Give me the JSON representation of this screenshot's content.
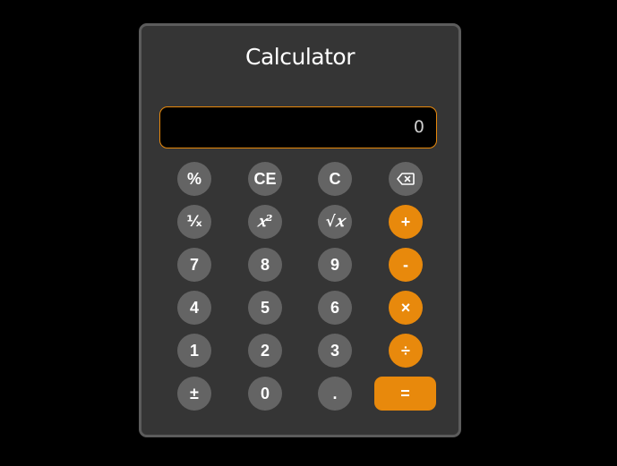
{
  "title": "Calculator",
  "display": {
    "value": "0"
  },
  "buttons": {
    "percent": "%",
    "clear_entry": "CE",
    "clear": "C",
    "backspace_icon": "backspace-icon",
    "reciprocal": "¹⁄ₓ",
    "square": "𝑥²",
    "sqrt": "√𝑥",
    "plus": "+",
    "seven": "7",
    "eight": "8",
    "nine": "9",
    "minus": "-",
    "four": "4",
    "five": "5",
    "six": "6",
    "multiply": "×",
    "one": "1",
    "two": "2",
    "three": "3",
    "divide": "÷",
    "negate": "±",
    "zero": "0",
    "decimal": ".",
    "equals": "="
  },
  "colors": {
    "background": "#000000",
    "panel": "#353535",
    "panel_border": "#5c5c5c",
    "button": "#646464",
    "accent": "#e8890c",
    "display_bg": "#000000",
    "display_text": "#cfcfcf"
  }
}
